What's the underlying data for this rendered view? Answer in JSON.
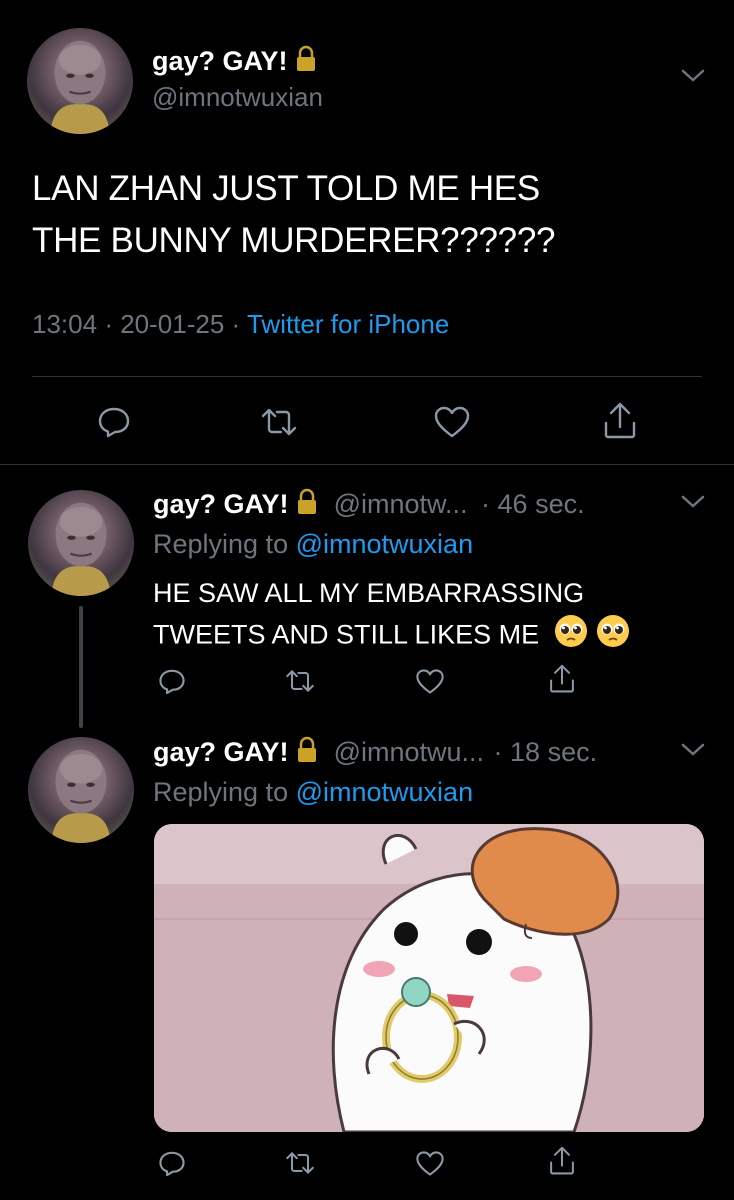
{
  "main_tweet": {
    "display_name": "gay? GAY!",
    "handle": "@imnotwuxian",
    "text_line1": "LAN ZHAN JUST TOLD ME HES",
    "text_line2": "THE BUNNY MURDERER??????",
    "time": "13:04",
    "sep1": "·",
    "date": "20-01-25",
    "sep2": "·",
    "source": "Twitter for iPhone"
  },
  "replies": [
    {
      "display_name": "gay? GAY!",
      "handle_truncated": "@imnotw...",
      "time_ago": "· 46 sec.",
      "replying_prefix": "Replying to",
      "replying_handle": "@imnotwuxian",
      "text_line1": "HE SAW ALL MY EMBARRASSING",
      "text_line2": "TWEETS AND STILL LIKES ME"
    },
    {
      "display_name": "gay? GAY!",
      "handle_truncated": "@imnotwu...",
      "time_ago": "· 18 sec.",
      "replying_prefix": "Replying to",
      "replying_handle": "@imnotwuxian"
    }
  ],
  "icons": {
    "reply": "reply-icon",
    "retweet": "retweet-icon",
    "like": "heart-icon",
    "share": "share-icon",
    "lock": "lock-icon",
    "caret": "chevron-down-icon",
    "emoji": "pleading-face-emoji"
  },
  "colors": {
    "background": "#000000",
    "link": "#1d9bf0",
    "muted": "#6e767d",
    "divider": "#2f3336"
  }
}
